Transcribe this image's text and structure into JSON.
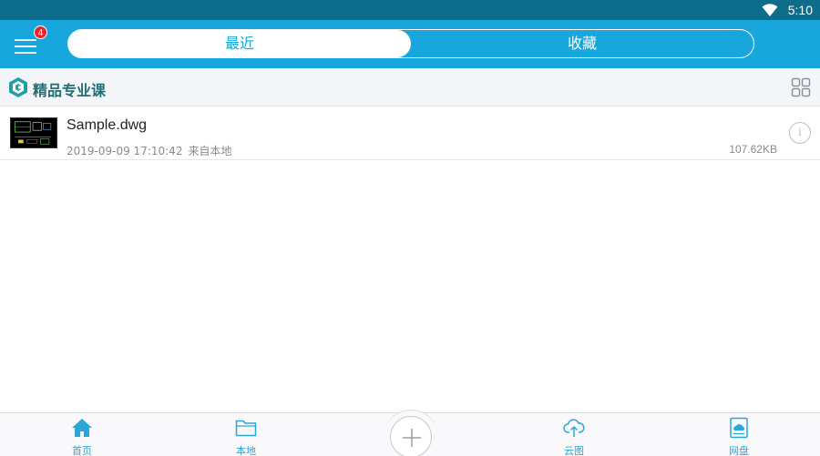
{
  "status_bar": {
    "time": "5:10",
    "icons": [
      "wifi-icon"
    ]
  },
  "app_bar": {
    "menu_icon": "hamburger-menu-icon",
    "badge_count": "4",
    "tabs": [
      {
        "label": "最近",
        "active": true
      },
      {
        "label": "收藏",
        "active": false
      }
    ],
    "accent_color": "#17a7dc"
  },
  "section": {
    "logo_icon": "brand-logo-icon",
    "title": "精品专业课",
    "view_toggle_icon": "grid-view-icon"
  },
  "files": [
    {
      "name": "Sample.dwg",
      "date": "2019-09-09 17:10:42",
      "source": "来自本地",
      "size": "107.62KB",
      "thumbnail_icon": "dwg-thumbnail-icon",
      "info_icon": "info-icon"
    }
  ],
  "bottom_nav": {
    "items": [
      {
        "label": "首页",
        "icon": "home-icon",
        "active": true
      },
      {
        "label": "本地",
        "icon": "folder-icon",
        "active": false
      },
      {
        "label": "云图",
        "icon": "cloud-upload-icon",
        "active": false
      },
      {
        "label": "网盘",
        "icon": "cloud-drive-icon",
        "active": false
      }
    ],
    "add_icon": "plus-icon"
  }
}
